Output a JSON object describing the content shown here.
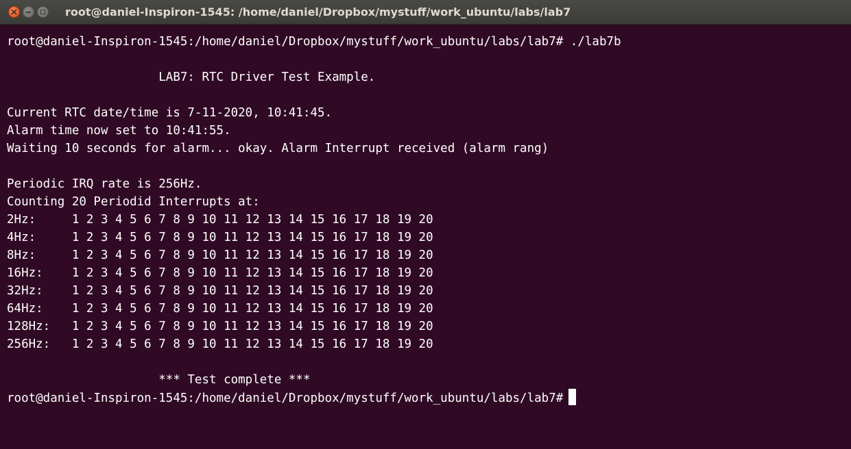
{
  "window": {
    "title": "root@daniel-Inspiron-1545: /home/daniel/Dropbox/mystuff/work_ubuntu/labs/lab7",
    "buttons": [
      "close-icon",
      "minimize-icon",
      "maximize-icon"
    ],
    "colors": {
      "terminal_background": "#300a24",
      "terminal_text": "#ffffff",
      "titlebar": "#3c3b37",
      "close_button": "#df4a16"
    }
  },
  "terminal": {
    "lines": [
      "root@daniel-Inspiron-1545:/home/daniel/Dropbox/mystuff/work_ubuntu/labs/lab7# ./lab7b",
      "",
      "                     LAB7: RTC Driver Test Example.",
      "",
      "Current RTC date/time is 7-11-2020, 10:41:45.",
      "Alarm time now set to 10:41:55.",
      "Waiting 10 seconds for alarm... okay. Alarm Interrupt received (alarm rang)",
      "",
      "Periodic IRQ rate is 256Hz.",
      "Counting 20 Periodid Interrupts at:",
      "2Hz:     1 2 3 4 5 6 7 8 9 10 11 12 13 14 15 16 17 18 19 20",
      "4Hz:     1 2 3 4 5 6 7 8 9 10 11 12 13 14 15 16 17 18 19 20",
      "8Hz:     1 2 3 4 5 6 7 8 9 10 11 12 13 14 15 16 17 18 19 20",
      "16Hz:    1 2 3 4 5 6 7 8 9 10 11 12 13 14 15 16 17 18 19 20",
      "32Hz:    1 2 3 4 5 6 7 8 9 10 11 12 13 14 15 16 17 18 19 20",
      "64Hz:    1 2 3 4 5 6 7 8 9 10 11 12 13 14 15 16 17 18 19 20",
      "128Hz:   1 2 3 4 5 6 7 8 9 10 11 12 13 14 15 16 17 18 19 20",
      "256Hz:   1 2 3 4 5 6 7 8 9 10 11 12 13 14 15 16 17 18 19 20",
      "",
      "                     *** Test complete ***"
    ],
    "prompt": "root@daniel-Inspiron-1545:/home/daniel/Dropbox/mystuff/work_ubuntu/labs/lab7#"
  }
}
